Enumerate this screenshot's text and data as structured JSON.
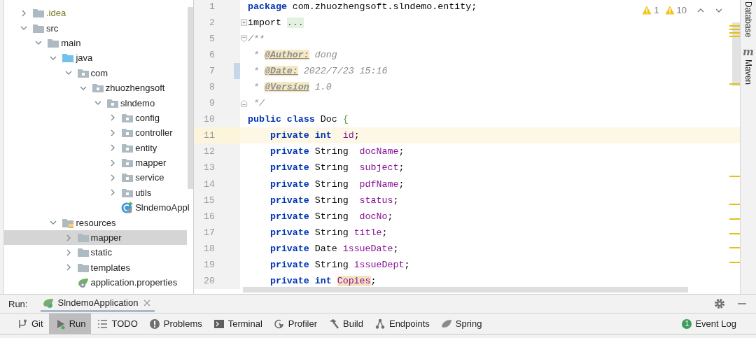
{
  "project_tree": [
    {
      "label": ".idea",
      "kind": "excluded",
      "expanded": false,
      "selected": false
    },
    {
      "label": "src",
      "kind": "folder",
      "expanded": true,
      "selected": false,
      "children": [
        {
          "label": "main",
          "kind": "folder",
          "expanded": true,
          "selected": false,
          "children": [
            {
              "label": "java",
              "kind": "source",
              "expanded": true,
              "selected": false,
              "children": [
                {
                  "label": "com",
                  "kind": "package",
                  "expanded": true,
                  "selected": false,
                  "children": [
                    {
                      "label": "zhuozhengsoft",
                      "kind": "package",
                      "expanded": true,
                      "selected": false,
                      "children": [
                        {
                          "label": "slndemo",
                          "kind": "package",
                          "expanded": true,
                          "selected": false,
                          "children": [
                            {
                              "label": "config",
                              "kind": "package",
                              "expanded": false,
                              "selected": false
                            },
                            {
                              "label": "controller",
                              "kind": "package",
                              "expanded": false,
                              "selected": false
                            },
                            {
                              "label": "entity",
                              "kind": "package",
                              "expanded": false,
                              "selected": false
                            },
                            {
                              "label": "mapper",
                              "kind": "package",
                              "expanded": false,
                              "selected": false
                            },
                            {
                              "label": "service",
                              "kind": "package",
                              "expanded": false,
                              "selected": false
                            },
                            {
                              "label": "utils",
                              "kind": "package",
                              "expanded": false,
                              "selected": false
                            },
                            {
                              "label": "SlndemoAppl",
                              "kind": "class",
                              "selected": false
                            }
                          ]
                        }
                      ]
                    }
                  ]
                }
              ]
            },
            {
              "label": "resources",
              "kind": "resources",
              "expanded": true,
              "selected": false,
              "children": [
                {
                  "label": "mapper",
                  "kind": "folder",
                  "expanded": false,
                  "selected": true
                },
                {
                  "label": "static",
                  "kind": "folder",
                  "expanded": false,
                  "selected": false
                },
                {
                  "label": "templates",
                  "kind": "folder",
                  "expanded": false,
                  "selected": false
                },
                {
                  "label": "application.properties",
                  "kind": "properties",
                  "selected": false
                }
              ]
            }
          ]
        }
      ]
    }
  ],
  "editor": {
    "warnings": [
      {
        "count": "1"
      },
      {
        "count": "10"
      }
    ],
    "lines": [
      {
        "number": "1",
        "kind": "plain",
        "current": false,
        "changed": false,
        "tokens": [
          {
            "kind": "kw",
            "text": "package"
          },
          {
            "kind": "txt",
            "text": " com.zhuozhengsoft.slndemo.entity;"
          }
        ]
      },
      {
        "number": "2",
        "kind": "folded",
        "current": false,
        "changed": false,
        "tokens": [
          {
            "kind": "txt",
            "text": "import "
          },
          {
            "kind": "folded",
            "text": "..."
          }
        ]
      },
      {
        "number": "5",
        "kind": "fold-start",
        "current": false,
        "changed": false,
        "tokens": [
          {
            "kind": "comment",
            "text": "/**"
          }
        ]
      },
      {
        "number": "6",
        "kind": "plain",
        "current": false,
        "changed": false,
        "tokens": [
          {
            "kind": "comment",
            "text": " * "
          },
          {
            "kind": "doctag",
            "text": "@Author:"
          },
          {
            "kind": "comment",
            "text": " dong"
          }
        ]
      },
      {
        "number": "7",
        "kind": "plain",
        "current": false,
        "changed": true,
        "tokens": [
          {
            "kind": "comment",
            "text": " * "
          },
          {
            "kind": "doctag",
            "text": "@Date:"
          },
          {
            "kind": "comment",
            "text": " 2022/7/23 15:16"
          }
        ]
      },
      {
        "number": "8",
        "kind": "plain",
        "current": false,
        "changed": false,
        "tokens": [
          {
            "kind": "comment",
            "text": " * "
          },
          {
            "kind": "doctag",
            "text": "@Version"
          },
          {
            "kind": "comment",
            "text": " 1.0"
          }
        ]
      },
      {
        "number": "9",
        "kind": "fold-end",
        "current": false,
        "changed": false,
        "tokens": [
          {
            "kind": "comment",
            "text": " */"
          }
        ]
      },
      {
        "number": "10",
        "kind": "plain",
        "current": false,
        "changed": false,
        "tokens": [
          {
            "kind": "kw",
            "text": "public class"
          },
          {
            "kind": "txt",
            "text": " Doc "
          },
          {
            "kind": "brace",
            "text": "{"
          }
        ]
      },
      {
        "number": "11",
        "kind": "plain",
        "current": true,
        "changed": false,
        "tokens": [
          {
            "kind": "kw",
            "text": "    private int"
          },
          {
            "kind": "field",
            "text": "  id"
          },
          {
            "kind": "txt",
            "text": ";"
          }
        ]
      },
      {
        "number": "12",
        "kind": "plain",
        "current": false,
        "changed": false,
        "tokens": [
          {
            "kind": "kw",
            "text": "    private"
          },
          {
            "kind": "txt",
            "text": " String  "
          },
          {
            "kind": "field",
            "text": "docName"
          },
          {
            "kind": "txt",
            "text": ";"
          }
        ]
      },
      {
        "number": "13",
        "kind": "plain",
        "current": false,
        "changed": false,
        "tokens": [
          {
            "kind": "kw",
            "text": "    private"
          },
          {
            "kind": "txt",
            "text": " String  "
          },
          {
            "kind": "field",
            "text": "subject"
          },
          {
            "kind": "txt",
            "text": ";"
          }
        ]
      },
      {
        "number": "14",
        "kind": "plain",
        "current": false,
        "changed": false,
        "tokens": [
          {
            "kind": "kw",
            "text": "    private"
          },
          {
            "kind": "txt",
            "text": " String  "
          },
          {
            "kind": "field",
            "text": "pdfName"
          },
          {
            "kind": "txt",
            "text": ";"
          }
        ]
      },
      {
        "number": "15",
        "kind": "plain",
        "current": false,
        "changed": false,
        "tokens": [
          {
            "kind": "kw",
            "text": "    private"
          },
          {
            "kind": "txt",
            "text": " String  "
          },
          {
            "kind": "field",
            "text": "status"
          },
          {
            "kind": "txt",
            "text": ";"
          }
        ]
      },
      {
        "number": "16",
        "kind": "plain",
        "current": false,
        "changed": false,
        "tokens": [
          {
            "kind": "kw",
            "text": "    private"
          },
          {
            "kind": "txt",
            "text": " String  "
          },
          {
            "kind": "field",
            "text": "docNo"
          },
          {
            "kind": "txt",
            "text": ";"
          }
        ]
      },
      {
        "number": "17",
        "kind": "plain",
        "current": false,
        "changed": false,
        "tokens": [
          {
            "kind": "kw",
            "text": "    private"
          },
          {
            "kind": "txt",
            "text": " String "
          },
          {
            "kind": "field",
            "text": "title"
          },
          {
            "kind": "txt",
            "text": ";"
          }
        ]
      },
      {
        "number": "18",
        "kind": "plain",
        "current": false,
        "changed": false,
        "tokens": [
          {
            "kind": "kw",
            "text": "    private"
          },
          {
            "kind": "txt",
            "text": " Date "
          },
          {
            "kind": "field",
            "text": "issueDate"
          },
          {
            "kind": "txt",
            "text": ";"
          }
        ]
      },
      {
        "number": "19",
        "kind": "plain",
        "current": false,
        "changed": false,
        "tokens": [
          {
            "kind": "kw",
            "text": "    private"
          },
          {
            "kind": "txt",
            "text": " String "
          },
          {
            "kind": "field",
            "text": "issueDept"
          },
          {
            "kind": "txt",
            "text": ";"
          }
        ]
      },
      {
        "number": "20",
        "kind": "plain",
        "current": false,
        "changed": false,
        "tokens": [
          {
            "kind": "kw",
            "text": "    private int "
          },
          {
            "kind": "usage",
            "text": "Copies"
          },
          {
            "kind": "txt",
            "text": ";"
          }
        ]
      }
    ]
  },
  "right_tool_strip": [
    {
      "label": "Database"
    },
    {
      "label": "Maven",
      "glyph": "m"
    }
  ],
  "run_panel": {
    "label": "Run:",
    "tabs": [
      {
        "label": "SlndemoApplication",
        "selected": true
      }
    ]
  },
  "tool_window_bar": [
    {
      "label": "Git",
      "kind": "git",
      "selected": false
    },
    {
      "label": "Run",
      "kind": "run",
      "selected": true
    },
    {
      "label": "TODO",
      "kind": "todo",
      "selected": false
    },
    {
      "label": "Problems",
      "kind": "problems",
      "selected": false
    },
    {
      "label": "Terminal",
      "kind": "terminal",
      "selected": false
    },
    {
      "label": "Profiler",
      "kind": "profiler",
      "selected": false
    },
    {
      "label": "Build",
      "kind": "build",
      "selected": false
    },
    {
      "label": "Endpoints",
      "kind": "endpoints",
      "selected": false
    },
    {
      "label": "Spring",
      "kind": "spring",
      "selected": false
    }
  ],
  "event_log": {
    "label": "Event Log",
    "badge": "1"
  }
}
